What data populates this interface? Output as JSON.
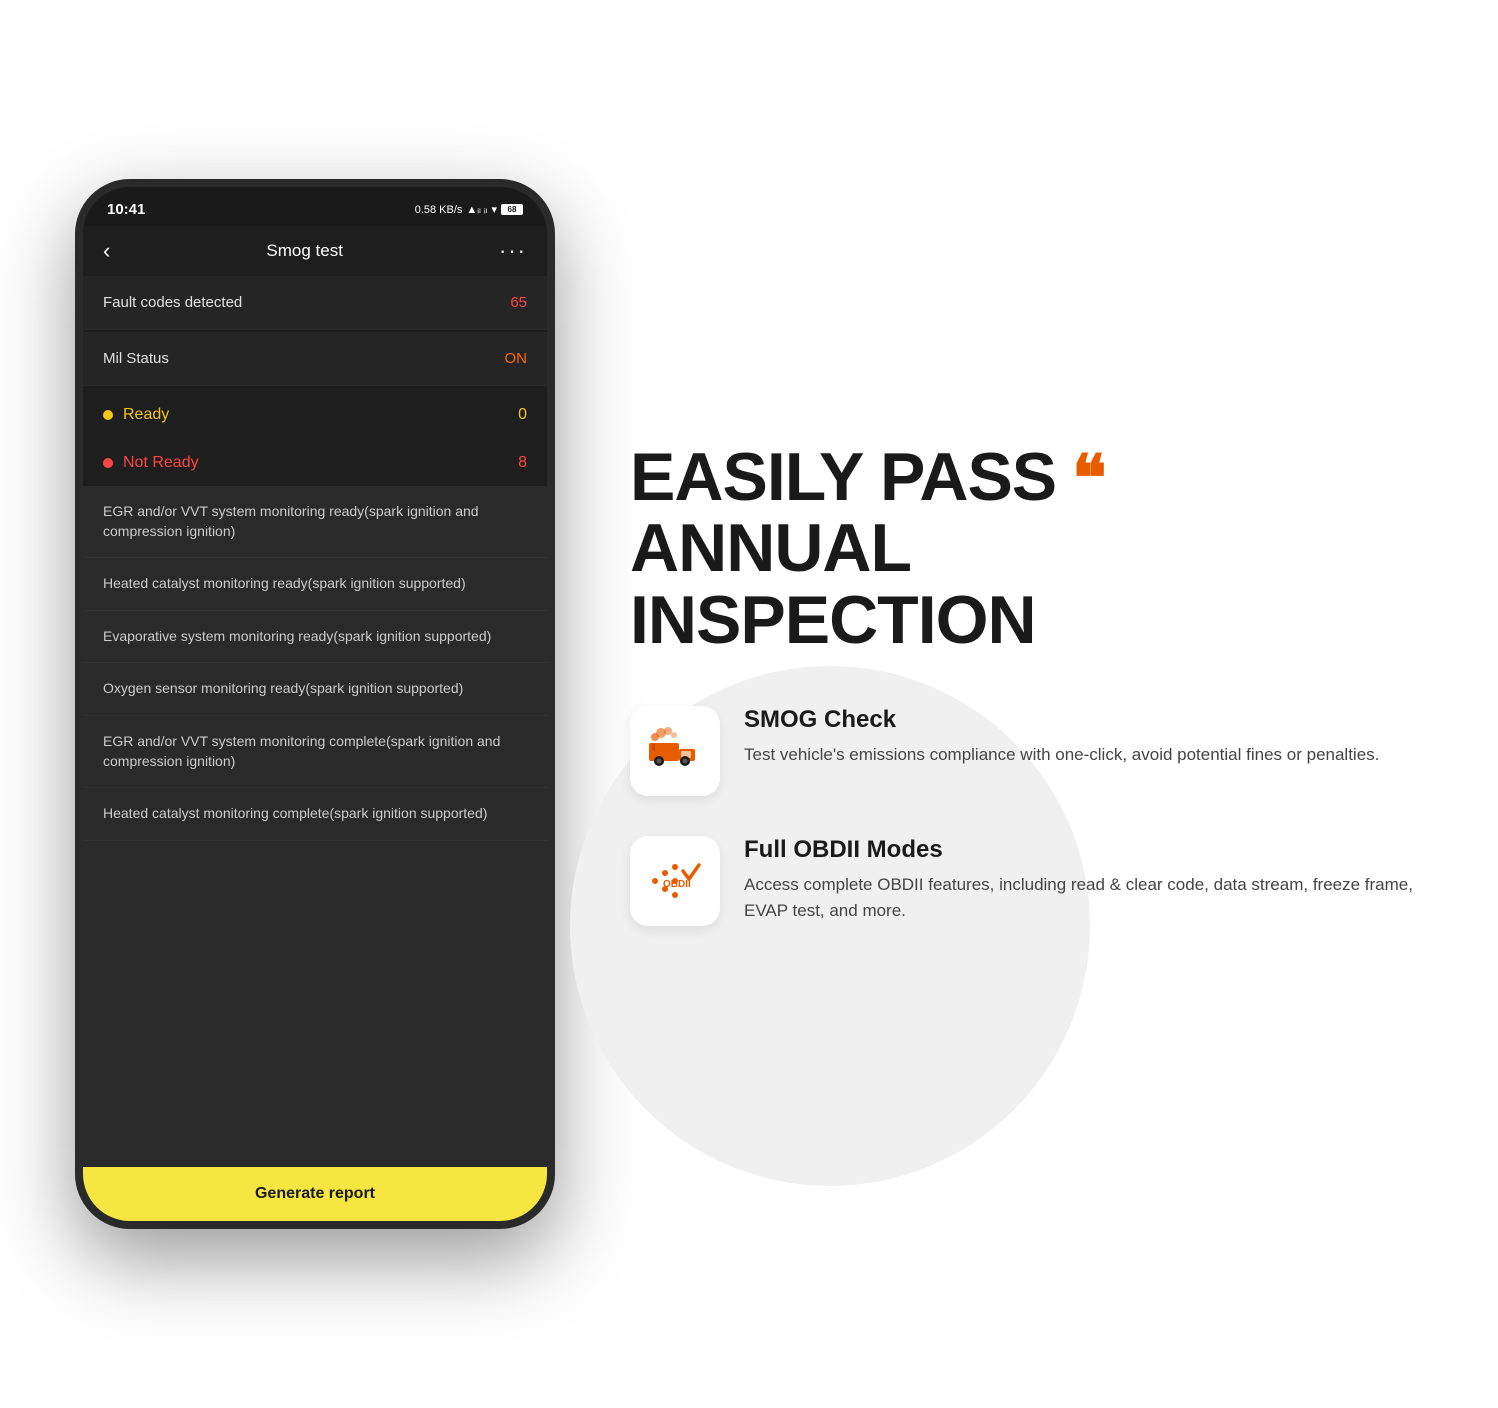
{
  "phone": {
    "status_bar": {
      "time": "10:41",
      "icons": "0.58 KB/s",
      "battery": "68"
    },
    "header": {
      "title": "Smog test",
      "back_label": "‹",
      "more_label": "···"
    },
    "fault_codes": {
      "label": "Fault codes detected",
      "value": "65"
    },
    "mil_status": {
      "label": "Mil Status",
      "value": "ON"
    },
    "ready": {
      "label": "Ready",
      "count": "0"
    },
    "not_ready": {
      "label": "Not Ready",
      "count": "8"
    },
    "list_items": [
      "EGR and/or VVT system monitoring ready(spark ignition and compression ignition)",
      "Heated catalyst monitoring ready(spark ignition supported)",
      "Evaporative system monitoring ready(spark ignition supported)",
      "Oxygen sensor monitoring ready(spark ignition supported)",
      "EGR and/or VVT system monitoring complete(spark ignition and compression ignition)",
      "Heated catalyst monitoring complete(spark ignition supported)"
    ],
    "generate_btn": "Generate report"
  },
  "headline": {
    "line1": "EASILY PASS",
    "line2": "ANNUAL",
    "line3": "INSPECTION"
  },
  "features": [
    {
      "id": "smog",
      "title": "SMOG Check",
      "description": "Test vehicle's emissions compliance with one-click, avoid potential fines or penalties."
    },
    {
      "id": "obdii",
      "title": "Full OBDII Modes",
      "description": "Access complete OBDII features, including read & clear code, data stream, freeze frame, EVAP test, and more."
    }
  ]
}
